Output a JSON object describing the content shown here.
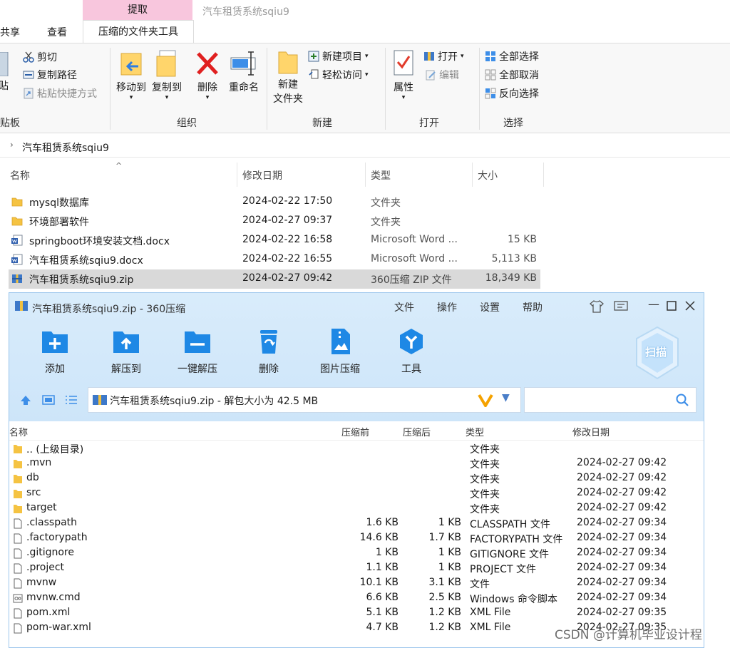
{
  "window": {
    "title": "汽车租赁系统sqiu9"
  },
  "tabs": {
    "context_header": "提取",
    "share": "共享",
    "view": "查看",
    "context_tool": "压缩的文件夹工具"
  },
  "ribbon": {
    "clipboard": {
      "paste": "贴",
      "cut": "剪切",
      "copy_path": "复制路径",
      "paste_shortcut": "粘贴快捷方式",
      "label": "贴板"
    },
    "organize": {
      "move_to": "移动到",
      "copy_to": "复制到",
      "delete": "删除",
      "rename": "重命名",
      "label": "组织"
    },
    "new": {
      "new_folder_1": "新建",
      "new_folder_2": "文件夹",
      "new_item": "新建项目",
      "easy_access": "轻松访问",
      "label": "新建"
    },
    "open": {
      "properties": "属性",
      "open": "打开",
      "edit": "编辑",
      "label": "打开"
    },
    "select": {
      "select_all": "全部选择",
      "select_none": "全部取消",
      "invert": "反向选择",
      "label": "选择"
    }
  },
  "address": {
    "path": "汽车租赁系统sqiu9"
  },
  "explorer": {
    "columns": {
      "name": "名称",
      "modified": "修改日期",
      "type": "类型",
      "size": "大小"
    },
    "rows": [
      {
        "name": "mysql数据库",
        "modified": "2024-02-22 17:50",
        "type": "文件夹",
        "size": "",
        "kind": "folder"
      },
      {
        "name": "环境部署软件",
        "modified": "2024-02-27 09:37",
        "type": "文件夹",
        "size": "",
        "kind": "folder"
      },
      {
        "name": "springboot环境安装文档.docx",
        "modified": "2024-02-22 16:58",
        "type": "Microsoft Word ...",
        "size": "15 KB",
        "kind": "word"
      },
      {
        "name": "汽车租赁系统sqiu9.docx",
        "modified": "2024-02-22 16:55",
        "type": "Microsoft Word ...",
        "size": "5,113 KB",
        "kind": "word"
      },
      {
        "name": "汽车租赁系统sqiu9.zip",
        "modified": "2024-02-27 09:42",
        "type": "360压缩 ZIP 文件",
        "size": "18,349 KB",
        "kind": "zip"
      }
    ]
  },
  "zip": {
    "title": "汽车租赁系统sqiu9.zip - 360压缩",
    "menu": {
      "file": "文件",
      "ops": "操作",
      "settings": "设置",
      "help": "帮助"
    },
    "tools": {
      "add": "添加",
      "extract_to": "解压到",
      "one_click": "一键解压",
      "delete": "删除",
      "image_compress": "图片压缩",
      "tools": "工具"
    },
    "scan": "扫描",
    "path": "汽车租赁系统sqiu9.zip - 解包大小为 42.5 MB",
    "columns": {
      "name": "名称",
      "before": "压缩前",
      "after": "压缩后",
      "type": "类型",
      "modified": "修改日期"
    },
    "rows": [
      {
        "name": ".. (上级目录)",
        "before": "",
        "after": "",
        "type": "文件夹",
        "modified": "",
        "kind": "folder"
      },
      {
        "name": ".mvn",
        "before": "",
        "after": "",
        "type": "文件夹",
        "modified": "2024-02-27 09:42",
        "kind": "folder"
      },
      {
        "name": "db",
        "before": "",
        "after": "",
        "type": "文件夹",
        "modified": "2024-02-27 09:42",
        "kind": "folder"
      },
      {
        "name": "src",
        "before": "",
        "after": "",
        "type": "文件夹",
        "modified": "2024-02-27 09:42",
        "kind": "folder"
      },
      {
        "name": "target",
        "before": "",
        "after": "",
        "type": "文件夹",
        "modified": "2024-02-27 09:42",
        "kind": "folder"
      },
      {
        "name": ".classpath",
        "before": "1.6 KB",
        "after": "1 KB",
        "type": "CLASSPATH 文件",
        "modified": "2024-02-27 09:34",
        "kind": "file"
      },
      {
        "name": ".factorypath",
        "before": "14.6 KB",
        "after": "1.7 KB",
        "type": "FACTORYPATH 文件",
        "modified": "2024-02-27 09:34",
        "kind": "file"
      },
      {
        "name": ".gitignore",
        "before": "1 KB",
        "after": "1 KB",
        "type": "GITIGNORE 文件",
        "modified": "2024-02-27 09:34",
        "kind": "file"
      },
      {
        "name": ".project",
        "before": "1.1 KB",
        "after": "1 KB",
        "type": "PROJECT 文件",
        "modified": "2024-02-27 09:34",
        "kind": "file"
      },
      {
        "name": "mvnw",
        "before": "10.1 KB",
        "after": "3.1 KB",
        "type": "文件",
        "modified": "2024-02-27 09:34",
        "kind": "file"
      },
      {
        "name": "mvnw.cmd",
        "before": "6.6 KB",
        "after": "2.5 KB",
        "type": "Windows 命令脚本",
        "modified": "2024-02-27 09:34",
        "kind": "cmd"
      },
      {
        "name": "pom.xml",
        "before": "5.1 KB",
        "after": "1.2 KB",
        "type": "XML File",
        "modified": "2024-02-27 09:35",
        "kind": "file"
      },
      {
        "name": "pom-war.xml",
        "before": "4.7 KB",
        "after": "1.2 KB",
        "type": "XML File",
        "modified": "2024-02-27 09:35",
        "kind": "file"
      }
    ]
  },
  "watermark": "CSDN @计算机毕业设计程"
}
